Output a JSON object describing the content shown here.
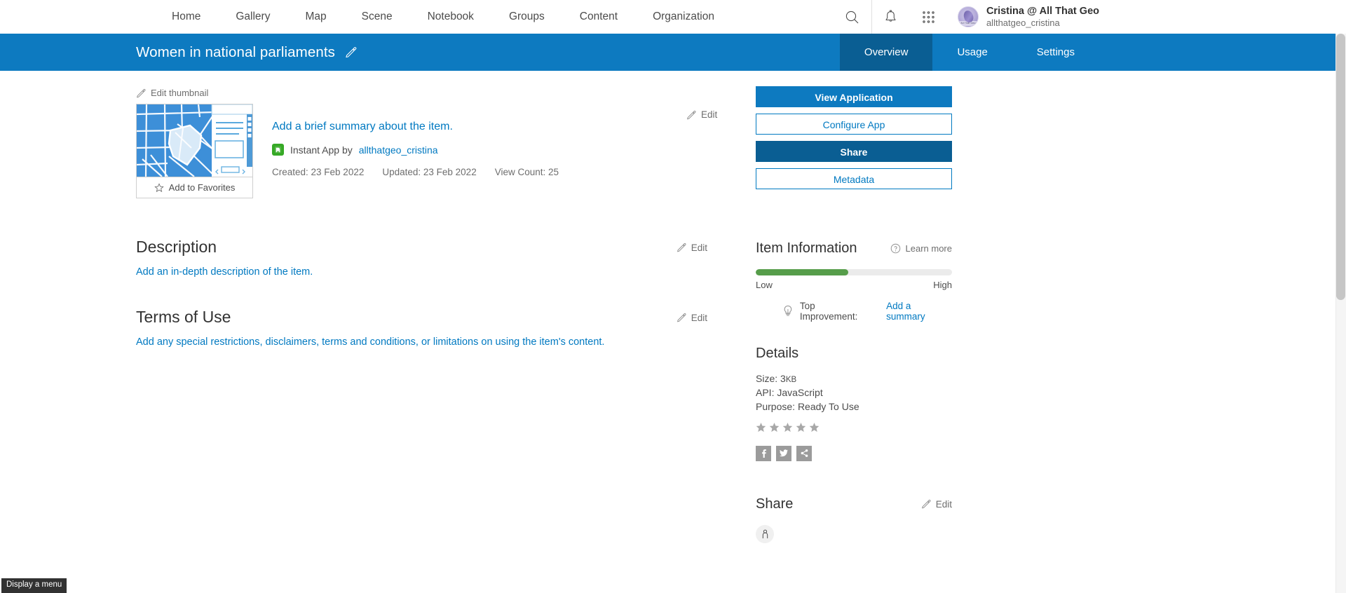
{
  "topnav": {
    "links": [
      "Home",
      "Gallery",
      "Map",
      "Scene",
      "Notebook",
      "Groups",
      "Content",
      "Organization"
    ],
    "search_label": "Search",
    "notifications_label": "Notifications",
    "apps_label": "App launcher",
    "user": {
      "name": "Cristina @ All That Geo",
      "handle": "allthatgeo_cristina",
      "avatar_caption": "All That Geo"
    }
  },
  "banner": {
    "title": "Women in national parliaments",
    "edit_title_label": "Edit title",
    "tabs": [
      {
        "label": "Overview",
        "active": true
      },
      {
        "label": "Usage",
        "active": false
      },
      {
        "label": "Settings",
        "active": false
      }
    ]
  },
  "item": {
    "edit_thumbnail": "Edit thumbnail",
    "favorites_label": "Add to Favorites",
    "summary_placeholder": "Add a brief summary about the item.",
    "type_label": "Instant App by",
    "owner": "allthatgeo_cristina",
    "created_label": "Created: 23 Feb 2022",
    "updated_label": "Updated: 23 Feb 2022",
    "views_label": "View Count: 25",
    "edit_label": "Edit"
  },
  "sections": {
    "description": {
      "title": "Description",
      "placeholder": "Add an in-depth description of the item.",
      "edit_label": "Edit"
    },
    "terms": {
      "title": "Terms of Use",
      "placeholder": "Add any special restrictions, disclaimers, terms and conditions, or limitations on using the item's content.",
      "edit_label": "Edit"
    }
  },
  "actions": {
    "view_application": "View Application",
    "configure_app": "Configure App",
    "share": "Share",
    "metadata": "Metadata"
  },
  "item_information": {
    "title": "Item Information",
    "learn_more": "Learn more",
    "low_label": "Low",
    "high_label": "High",
    "completeness_percent": 47,
    "top_improvement_label": "Top Improvement:",
    "top_improvement_action": "Add a summary"
  },
  "details": {
    "title": "Details",
    "size_label": "Size:",
    "size_value": "3",
    "size_unit": "KB",
    "api_label": "API:",
    "api_value": "JavaScript",
    "purpose_label": "Purpose:",
    "purpose_value": "Ready To Use",
    "rating_stars": 5,
    "rating_filled": 0,
    "social": [
      "facebook-icon",
      "twitter-icon",
      "share-icon"
    ]
  },
  "share_section": {
    "title": "Share",
    "edit_label": "Edit"
  },
  "tooltip": {
    "text": "Display a menu"
  },
  "colors": {
    "banner_blue": "#0d7ac0",
    "tab_active_blue": "#0a5e93",
    "link_blue": "#0079c1",
    "green_bar": "#569d4a",
    "type_green": "#36a926"
  }
}
